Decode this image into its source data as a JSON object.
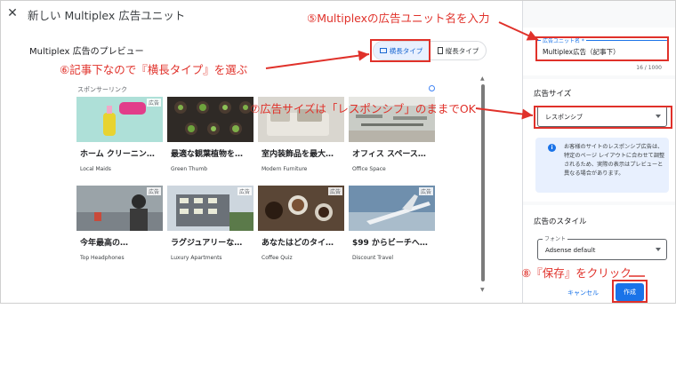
{
  "window": {
    "title": "新しい Multiplex 広告ユニット",
    "close_icon": "close-icon"
  },
  "preview": {
    "title": "Multiplex 広告のプレビュー",
    "type_horizontal": "横長タイプ",
    "type_vertical": "縦長タイプ",
    "sponsored": "スポンサーリンク",
    "ad_tag": "広告",
    "cards": [
      {
        "headline": "ホーム クリーニン…",
        "source": "Local Maids"
      },
      {
        "headline": "最適な観葉植物を…",
        "source": "Green Thumb"
      },
      {
        "headline": "室内装飾品を最大…",
        "source": "Modern Furniture"
      },
      {
        "headline": "オフィス スペース…",
        "source": "Office Space"
      },
      {
        "headline": "今年最高の…",
        "source": "Top Headphones"
      },
      {
        "headline": "ラグジュアリーな…",
        "source": "Luxury Apartments"
      },
      {
        "headline": "あなたはどのタイ…",
        "source": "Coffee Quiz"
      },
      {
        "headline": "$99 からビーチへ…",
        "source": "Discount Travel"
      }
    ]
  },
  "settings": {
    "name_label": "広告ユニット名 *",
    "name_value": "Multiplex広告（記事下）",
    "name_count": "16 / 1000",
    "size_heading": "広告サイズ",
    "size_value": "レスポンシブ",
    "info_text": "お客様のサイトのレスポンシブ広告は、特定のページ レイアウトに合わせて調整されるため、実際の表示はプレビューと異なる場合があります。",
    "style_heading": "広告のスタイル",
    "font_label": "フォント",
    "font_value": "Adsense default",
    "cancel_label": "キャンセル",
    "create_label": "作成"
  },
  "annotations": {
    "a5": "⑤Multiplexの広告ユニット名を入力",
    "a6": "⑥記事下なので『横長タイプ』を選ぶ",
    "a7": "⑦広告サイズは「レスポンシブ」のままでOK",
    "a8": "⑧『保存』をクリック"
  },
  "colors": {
    "accent": "#1a73e8",
    "annotation": "#e0312a",
    "selected_bg": "#e8f0fe"
  }
}
